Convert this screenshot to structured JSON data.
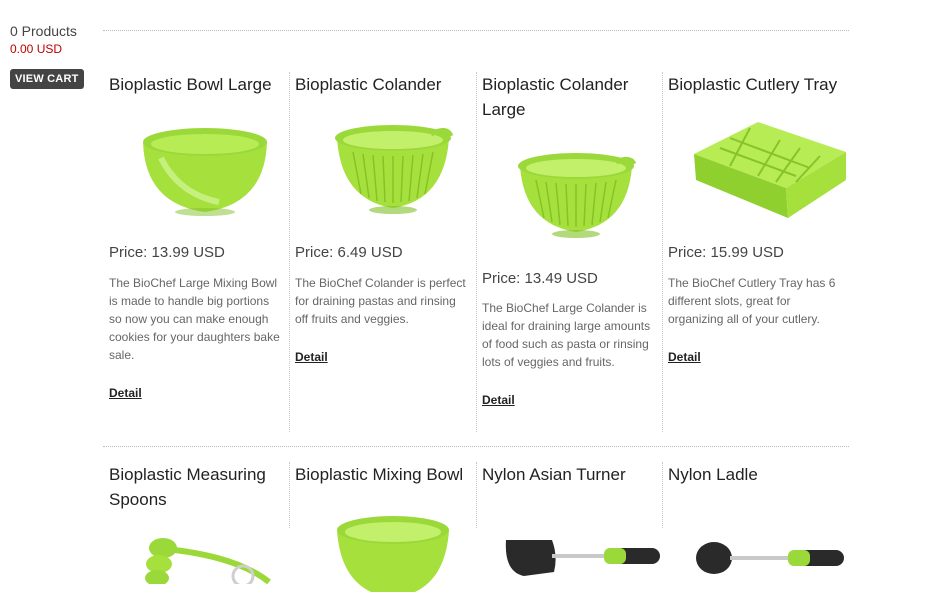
{
  "cart": {
    "count_text": "0 Products",
    "total_text": "0.00 USD",
    "button_label": "VIEW CART"
  },
  "products": [
    {
      "title": "Bioplastic Bowl Large",
      "price": "Price: 13.99 USD",
      "description": "The BioChef Large Mixing Bowl is made to handle big portions so now you can make enough cookies for your daughters bake sale.",
      "detail": "Detail"
    },
    {
      "title": "Bioplastic Colander",
      "price": "Price: 6.49 USD",
      "description": "The BioChef Colander is perfect for draining pastas and rinsing off fruits and veggies.",
      "detail": "Detail"
    },
    {
      "title": "Bioplastic Colander Large",
      "price": "Price: 13.49 USD",
      "description": "The BioChef Large Colander is ideal for draining large amounts of food such as pasta or rinsing lots of veggies and fruits.",
      "detail": "Detail"
    },
    {
      "title": "Bioplastic Cutlery Tray",
      "price": "Price: 15.99 USD",
      "description": "The BioChef Cutlery Tray has 6 different slots, great for organizing all of your cutlery.",
      "detail": "Detail"
    },
    {
      "title": "Bioplastic Measuring Spoons"
    },
    {
      "title": "Bioplastic Mixing Bowl"
    },
    {
      "title": "Nylon Asian Turner"
    },
    {
      "title": "Nylon Ladle"
    }
  ],
  "colors": {
    "accent_green": "#9bd93a",
    "price_red": "#c00000",
    "button_bg": "#444444"
  }
}
